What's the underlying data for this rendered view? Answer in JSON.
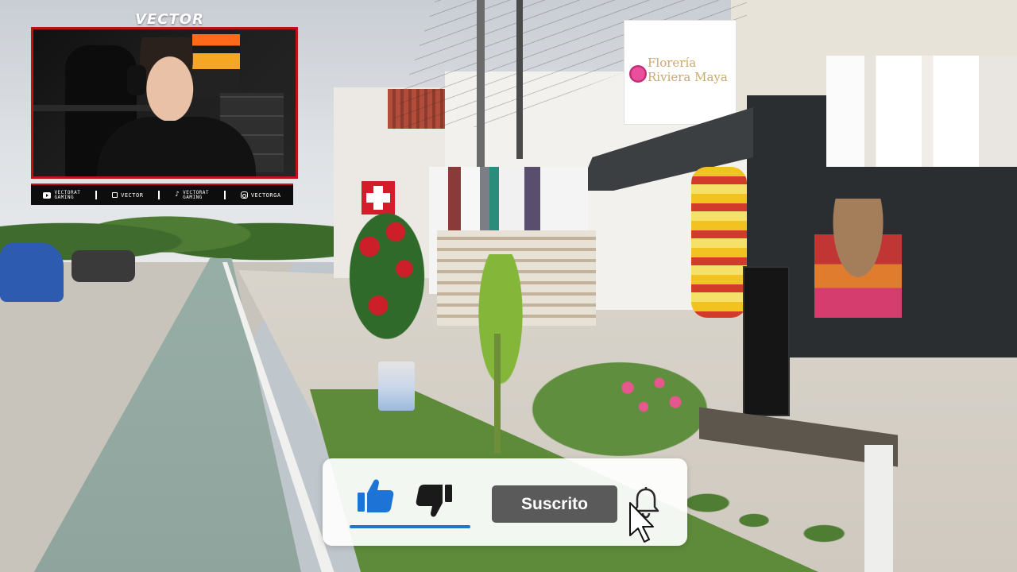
{
  "overlay": {
    "brand_watermark": "VECTOR",
    "socials": [
      {
        "icon": "youtube-icon",
        "label": "VECTORAT\nGAMING"
      },
      {
        "icon": "twitch-icon",
        "label": "VECTOR"
      },
      {
        "icon": "tiktok-icon",
        "label": "VECTORAT\nGAMING"
      },
      {
        "icon": "instagram-icon",
        "label": "VECTORGA"
      }
    ],
    "accent_color": "#c0111b"
  },
  "scene": {
    "shop_sign": "Florería\nRiviera Maya"
  },
  "subscribe_widget": {
    "like_icon": "thumbs-up-icon",
    "dislike_icon": "thumbs-down-icon",
    "subscribed_label": "Suscrito",
    "bell_icon": "bell-icon",
    "like_color": "#1e73d6",
    "button_color": "#5a5a5a"
  }
}
